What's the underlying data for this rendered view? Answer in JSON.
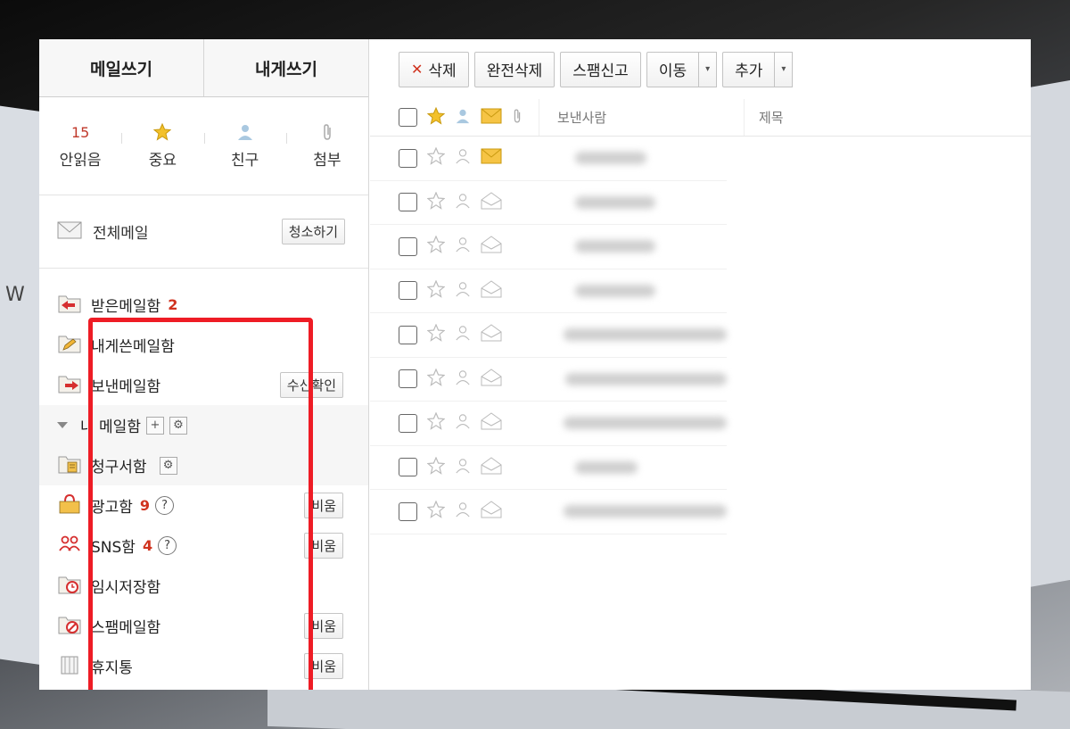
{
  "compose": {
    "write_mail": "메일쓰기",
    "write_self": "내게쓰기"
  },
  "quick": [
    {
      "top": "15",
      "label": "안읽음",
      "icon": "count"
    },
    {
      "top": "",
      "label": "중요",
      "icon": "star-icon"
    },
    {
      "top": "",
      "label": "친구",
      "icon": "person-icon"
    },
    {
      "top": "",
      "label": "첨부",
      "icon": "paperclip-icon"
    }
  ],
  "all_mail": {
    "label": "전체메일",
    "clean_button": "청소하기"
  },
  "folders": {
    "inbox": {
      "label": "받은메일함",
      "count": "2"
    },
    "self_sent": {
      "label": "내게쓴메일함"
    },
    "sent": {
      "label": "보낸메일함",
      "button": "수신확인"
    },
    "my_mailbox": {
      "label": "내 메일함",
      "add": "+",
      "settings": "⚙"
    },
    "bills": {
      "label": "청구서함",
      "settings": "⚙"
    },
    "ads": {
      "label": "광고함",
      "count": "9",
      "help": "?",
      "button": "비움"
    },
    "sns": {
      "label": "SNS함",
      "count": "4",
      "help": "?",
      "button": "비움"
    },
    "drafts": {
      "label": "임시저장함"
    },
    "spam": {
      "label": "스팸메일함",
      "button": "비움"
    },
    "trash": {
      "label": "휴지통",
      "button": "비움"
    }
  },
  "toolbar": {
    "delete": "삭제",
    "delete_x": "✕",
    "perm_delete": "완전삭제",
    "report_spam": "스팸신고",
    "move": "이동",
    "more": "추가",
    "caret": "▾"
  },
  "list": {
    "col_sender": "보낸사람",
    "col_subject": "제목",
    "rows": [
      {
        "unread": true,
        "sender_width": 80
      },
      {
        "unread": false,
        "sender_width": 90
      },
      {
        "unread": false,
        "sender_width": 90
      },
      {
        "unread": false,
        "sender_width": 90
      },
      {
        "unread": false,
        "sender_width": 200
      },
      {
        "unread": false,
        "sender_width": 195
      },
      {
        "unread": false,
        "sender_width": 200
      },
      {
        "unread": false,
        "sender_width": 70
      },
      {
        "unread": false,
        "sender_width": 200
      }
    ]
  }
}
